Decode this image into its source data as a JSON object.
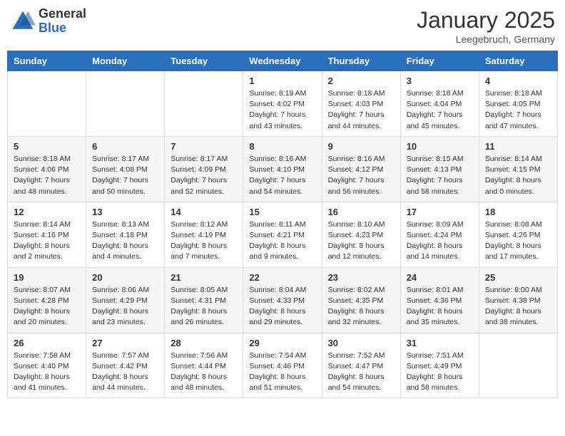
{
  "header": {
    "logo_general": "General",
    "logo_blue": "Blue",
    "month_year": "January 2025",
    "location": "Leegebruch, Germany"
  },
  "days_of_week": [
    "Sunday",
    "Monday",
    "Tuesday",
    "Wednesday",
    "Thursday",
    "Friday",
    "Saturday"
  ],
  "weeks": [
    [
      {
        "day": "",
        "info": ""
      },
      {
        "day": "",
        "info": ""
      },
      {
        "day": "",
        "info": ""
      },
      {
        "day": "1",
        "info": "Sunrise: 8:19 AM\nSunset: 4:02 PM\nDaylight: 7 hours and 43 minutes."
      },
      {
        "day": "2",
        "info": "Sunrise: 8:18 AM\nSunset: 4:03 PM\nDaylight: 7 hours and 44 minutes."
      },
      {
        "day": "3",
        "info": "Sunrise: 8:18 AM\nSunset: 4:04 PM\nDaylight: 7 hours and 45 minutes."
      },
      {
        "day": "4",
        "info": "Sunrise: 8:18 AM\nSunset: 4:05 PM\nDaylight: 7 hours and 47 minutes."
      }
    ],
    [
      {
        "day": "5",
        "info": "Sunrise: 8:18 AM\nSunset: 4:06 PM\nDaylight: 7 hours and 48 minutes."
      },
      {
        "day": "6",
        "info": "Sunrise: 8:17 AM\nSunset: 4:08 PM\nDaylight: 7 hours and 50 minutes."
      },
      {
        "day": "7",
        "info": "Sunrise: 8:17 AM\nSunset: 4:09 PM\nDaylight: 7 hours and 52 minutes."
      },
      {
        "day": "8",
        "info": "Sunrise: 8:16 AM\nSunset: 4:10 PM\nDaylight: 7 hours and 54 minutes."
      },
      {
        "day": "9",
        "info": "Sunrise: 8:16 AM\nSunset: 4:12 PM\nDaylight: 7 hours and 56 minutes."
      },
      {
        "day": "10",
        "info": "Sunrise: 8:15 AM\nSunset: 4:13 PM\nDaylight: 7 hours and 58 minutes."
      },
      {
        "day": "11",
        "info": "Sunrise: 8:14 AM\nSunset: 4:15 PM\nDaylight: 8 hours and 0 minutes."
      }
    ],
    [
      {
        "day": "12",
        "info": "Sunrise: 8:14 AM\nSunset: 4:16 PM\nDaylight: 8 hours and 2 minutes."
      },
      {
        "day": "13",
        "info": "Sunrise: 8:13 AM\nSunset: 4:18 PM\nDaylight: 8 hours and 4 minutes."
      },
      {
        "day": "14",
        "info": "Sunrise: 8:12 AM\nSunset: 4:19 PM\nDaylight: 8 hours and 7 minutes."
      },
      {
        "day": "15",
        "info": "Sunrise: 8:11 AM\nSunset: 4:21 PM\nDaylight: 8 hours and 9 minutes."
      },
      {
        "day": "16",
        "info": "Sunrise: 8:10 AM\nSunset: 4:23 PM\nDaylight: 8 hours and 12 minutes."
      },
      {
        "day": "17",
        "info": "Sunrise: 8:09 AM\nSunset: 4:24 PM\nDaylight: 8 hours and 14 minutes."
      },
      {
        "day": "18",
        "info": "Sunrise: 8:08 AM\nSunset: 4:26 PM\nDaylight: 8 hours and 17 minutes."
      }
    ],
    [
      {
        "day": "19",
        "info": "Sunrise: 8:07 AM\nSunset: 4:28 PM\nDaylight: 8 hours and 20 minutes."
      },
      {
        "day": "20",
        "info": "Sunrise: 8:06 AM\nSunset: 4:29 PM\nDaylight: 8 hours and 23 minutes."
      },
      {
        "day": "21",
        "info": "Sunrise: 8:05 AM\nSunset: 4:31 PM\nDaylight: 8 hours and 26 minutes."
      },
      {
        "day": "22",
        "info": "Sunrise: 8:04 AM\nSunset: 4:33 PM\nDaylight: 8 hours and 29 minutes."
      },
      {
        "day": "23",
        "info": "Sunrise: 8:02 AM\nSunset: 4:35 PM\nDaylight: 8 hours and 32 minutes."
      },
      {
        "day": "24",
        "info": "Sunrise: 8:01 AM\nSunset: 4:36 PM\nDaylight: 8 hours and 35 minutes."
      },
      {
        "day": "25",
        "info": "Sunrise: 8:00 AM\nSunset: 4:38 PM\nDaylight: 8 hours and 38 minutes."
      }
    ],
    [
      {
        "day": "26",
        "info": "Sunrise: 7:58 AM\nSunset: 4:40 PM\nDaylight: 8 hours and 41 minutes."
      },
      {
        "day": "27",
        "info": "Sunrise: 7:57 AM\nSunset: 4:42 PM\nDaylight: 8 hours and 44 minutes."
      },
      {
        "day": "28",
        "info": "Sunrise: 7:56 AM\nSunset: 4:44 PM\nDaylight: 8 hours and 48 minutes."
      },
      {
        "day": "29",
        "info": "Sunrise: 7:54 AM\nSunset: 4:46 PM\nDaylight: 8 hours and 51 minutes."
      },
      {
        "day": "30",
        "info": "Sunrise: 7:52 AM\nSunset: 4:47 PM\nDaylight: 8 hours and 54 minutes."
      },
      {
        "day": "31",
        "info": "Sunrise: 7:51 AM\nSunset: 4:49 PM\nDaylight: 8 hours and 58 minutes."
      },
      {
        "day": "",
        "info": ""
      }
    ]
  ]
}
